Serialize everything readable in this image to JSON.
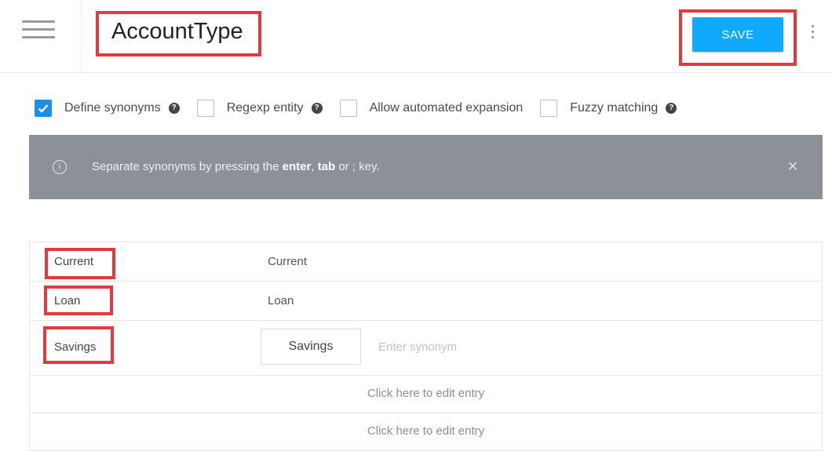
{
  "header": {
    "title": "AccountType",
    "save_label": "SAVE"
  },
  "options": [
    {
      "label": "Define synonyms",
      "checked": true,
      "help": true
    },
    {
      "label": "Regexp entity",
      "checked": false,
      "help": true
    },
    {
      "label": "Allow automated expansion",
      "checked": false,
      "help": false
    },
    {
      "label": "Fuzzy matching",
      "checked": false,
      "help": true
    }
  ],
  "banner": {
    "text_before": "Separate synonyms by pressing the ",
    "enter_key": "enter",
    "tab_key": "tab",
    "text_after": " or ; key.",
    "close": "×"
  },
  "entries": [
    {
      "reference": "Current",
      "synonym": "Current"
    },
    {
      "reference": "Loan",
      "synonym": "Loan"
    },
    {
      "reference": "Savings",
      "synonym": "Savings",
      "placeholder": "Enter synonym"
    }
  ],
  "edit_rows": [
    "Click here to edit entry",
    "Click here to edit entry"
  ],
  "colors": {
    "save_button": "#0fa9ff",
    "checkbox_checked": "#1a8fe8",
    "banner": "#8c9099",
    "highlight": "#e23a3f"
  }
}
